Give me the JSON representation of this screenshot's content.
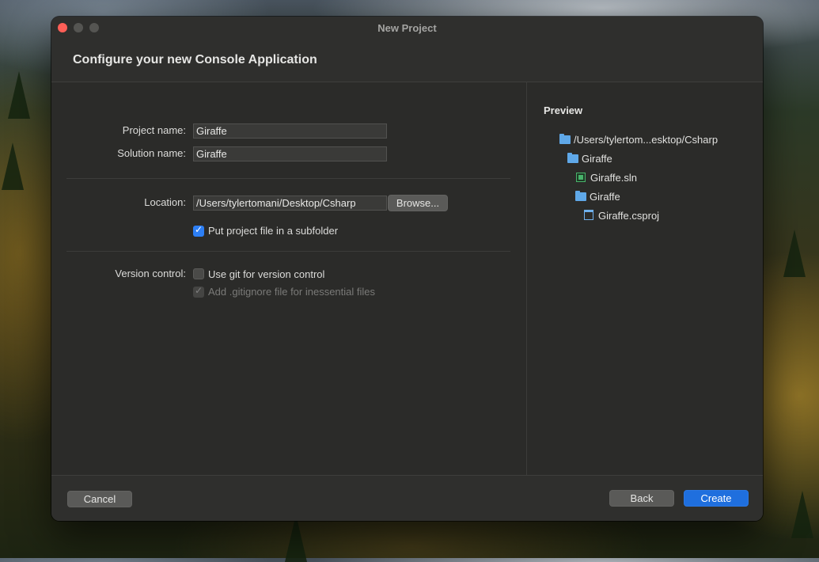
{
  "window": {
    "title": "New Project"
  },
  "header": {
    "title": "Configure your new Console Application"
  },
  "form": {
    "project_name_label": "Project name:",
    "project_name_value": "Giraffe",
    "solution_name_label": "Solution name:",
    "solution_name_value": "Giraffe",
    "location_label": "Location:",
    "location_value": "/Users/tylertomani/Desktop/Csharp",
    "browse_label": "Browse...",
    "subfolder_label": "Put project file in a subfolder",
    "subfolder_checked": true,
    "version_control_label": "Version control:",
    "git_label": "Use git for version control",
    "git_checked": false,
    "gitignore_label": "Add .gitignore file for inessential files",
    "gitignore_checked": true,
    "gitignore_enabled": false
  },
  "preview": {
    "title": "Preview",
    "tree": [
      {
        "label": "/Users/tylertom...esktop/Csharp",
        "icon": "folder-icon"
      },
      {
        "label": "Giraffe",
        "icon": "folder-icon"
      },
      {
        "label": "Giraffe.sln",
        "icon": "solution-file-icon"
      },
      {
        "label": "Giraffe",
        "icon": "folder-icon"
      },
      {
        "label": "Giraffe.csproj",
        "icon": "project-file-icon"
      }
    ]
  },
  "footer": {
    "cancel_label": "Cancel",
    "back_label": "Back",
    "create_label": "Create"
  },
  "colors": {
    "accent": "#1f6fde",
    "close": "#ff5f57",
    "folder": "#5fa8e8",
    "solution": "#48b36a"
  }
}
